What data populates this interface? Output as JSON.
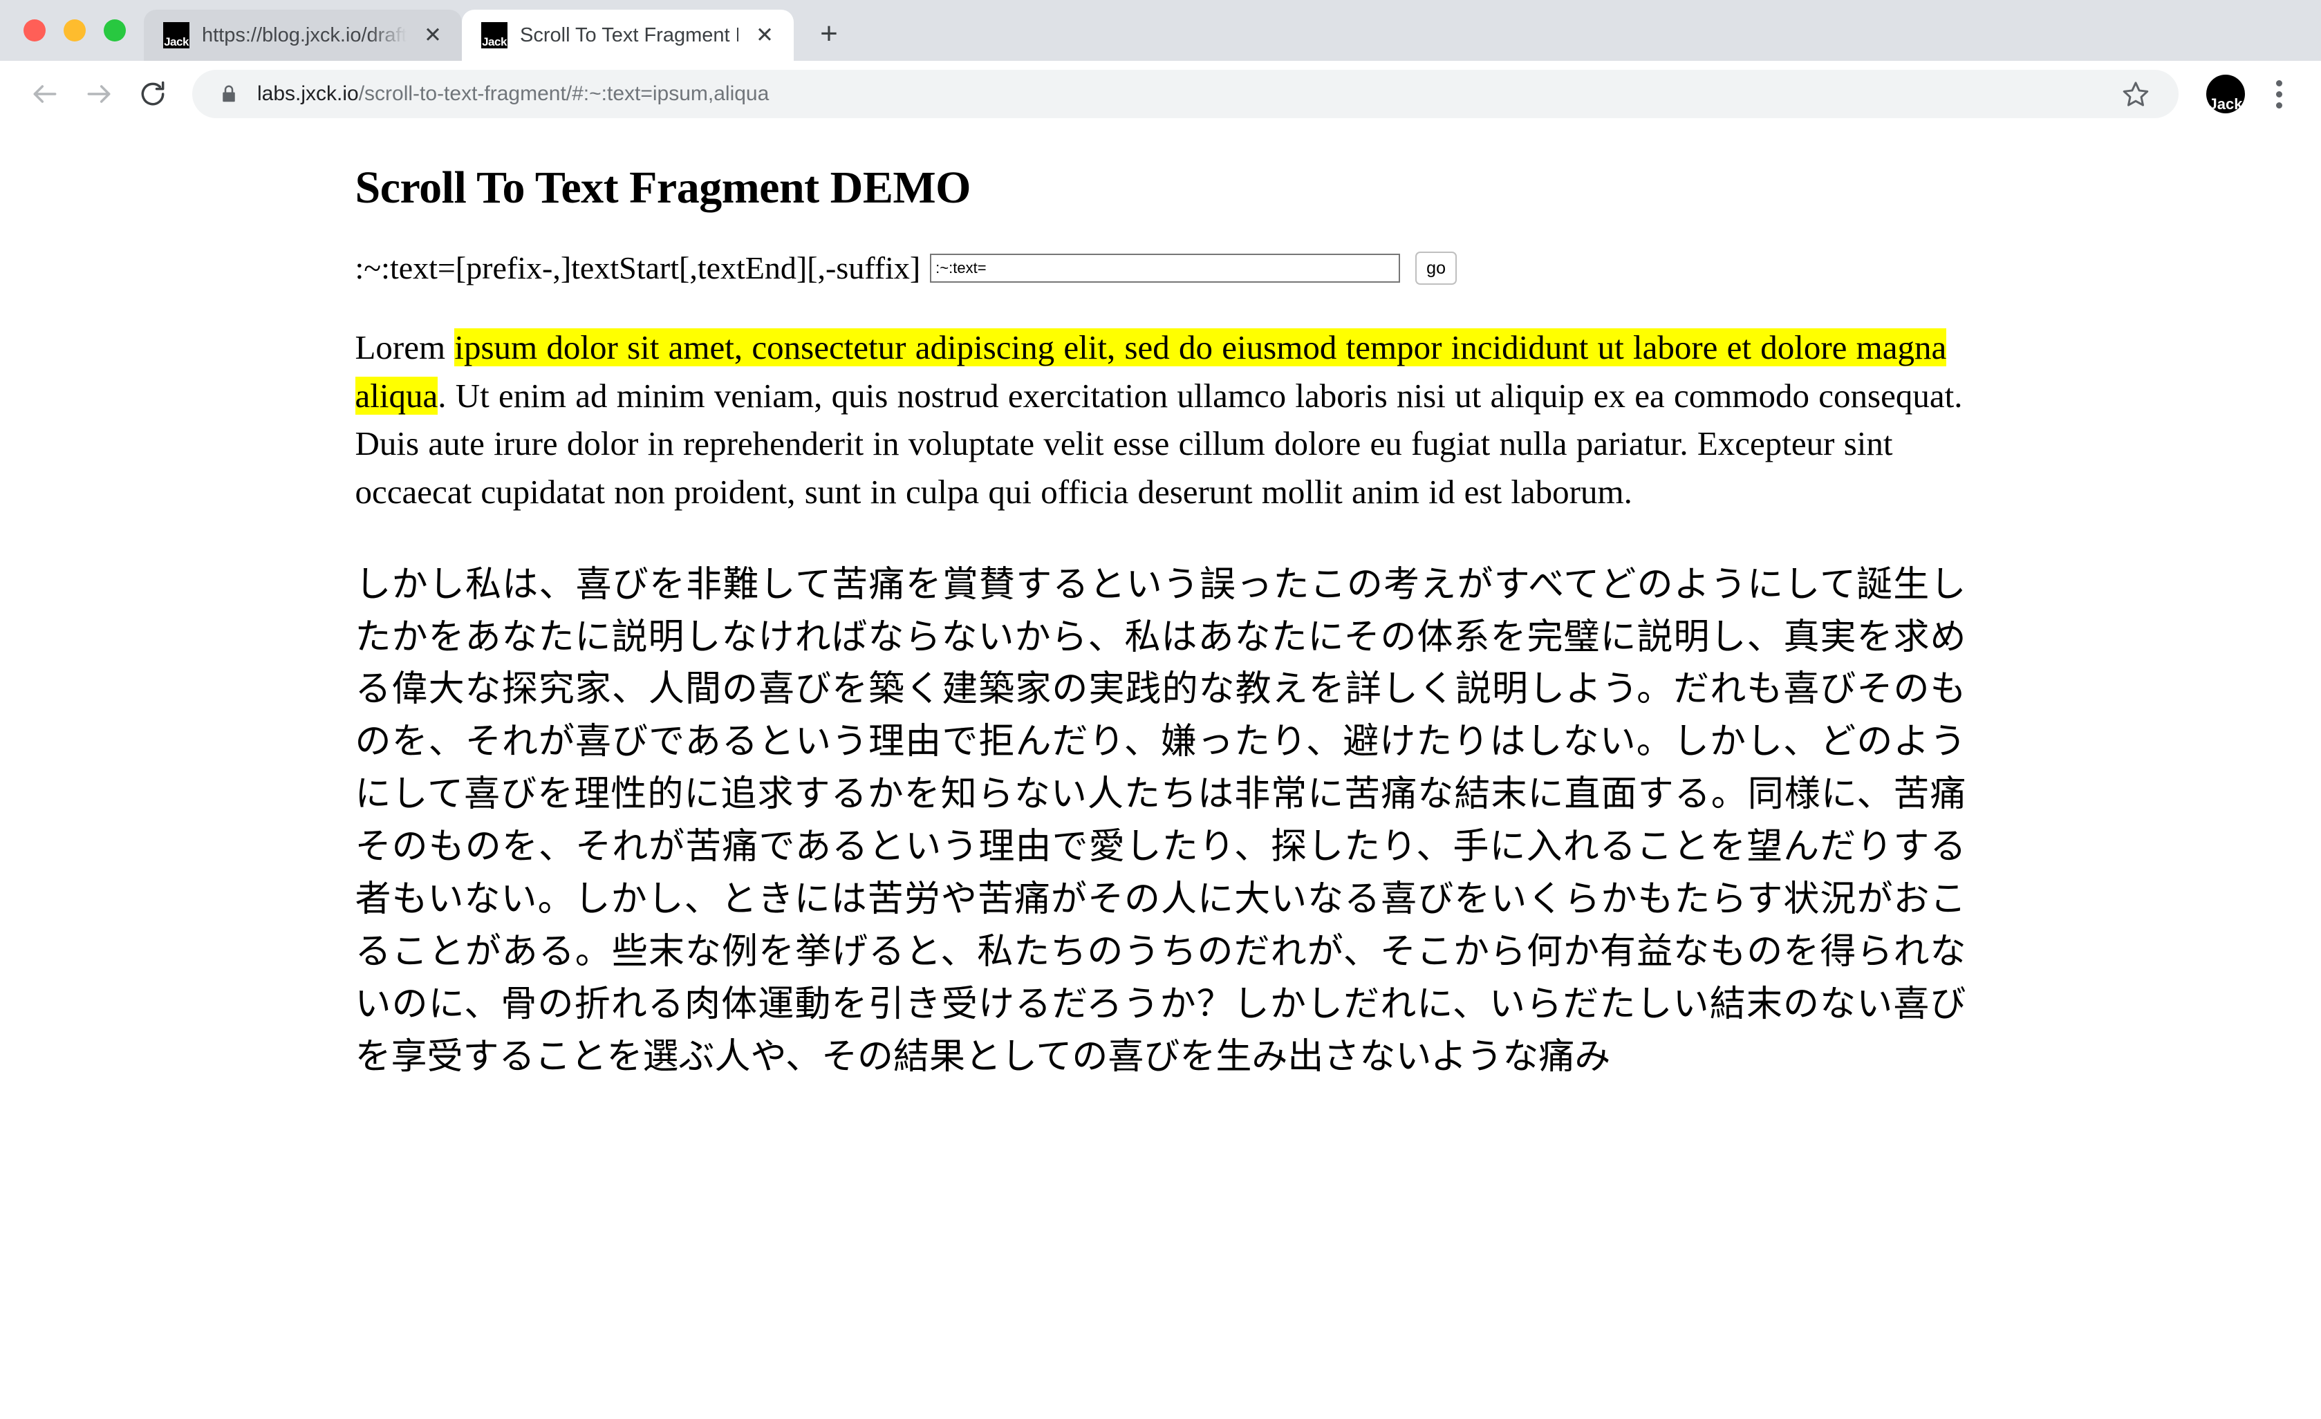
{
  "browser": {
    "window_controls": {
      "close_label": "close",
      "minimize_label": "minimize",
      "maximize_label": "maximize"
    },
    "tabs": [
      {
        "title": "https://blog.jxck.io/drafts/scroll-t",
        "favicon_label": "Jack",
        "active": false,
        "close_glyph": "✕"
      },
      {
        "title": "Scroll To Text Fragment DEMO",
        "favicon_label": "Jack",
        "active": true,
        "close_glyph": "✕"
      }
    ],
    "new_tab_glyph": "+",
    "toolbar": {
      "back_icon": "back-arrow-icon",
      "forward_icon": "forward-arrow-icon",
      "reload_icon": "reload-icon",
      "lock_icon": "lock-icon",
      "url_host": "labs.jxck.io",
      "url_path": "/scroll-to-text-fragment/#:~:text=ipsum,aliqua",
      "url_full": "labs.jxck.io/scroll-to-text-fragment/#:~:text=ipsum,aliqua",
      "bookmark_icon": "star-icon",
      "profile_label": "Jack",
      "menu_icon": "three-dot-menu-icon"
    }
  },
  "page": {
    "title": "Scroll To Text Fragment DEMO",
    "form": {
      "label": ":~:text=[prefix-,]textStart[,textEnd][,-suffix]",
      "input_value": ":~:text=",
      "input_placeholder": ":~:text=",
      "submit_label": "go"
    },
    "latin_paragraph": {
      "before_highlight": "Lorem ",
      "highlight": "ipsum dolor sit amet, consectetur adipiscing elit, sed do eiusmod tempor incididunt ut labore et dolore magna aliqua",
      "after_highlight": ". Ut enim ad minim veniam, quis nostrud exercitation ullamco laboris nisi ut aliquip ex ea commodo consequat. Duis aute irure dolor in reprehenderit in voluptate velit esse cillum dolore eu fugiat nulla pariatur. Excepteur sint occaecat cupidatat non proident, sunt in culpa qui officia deserunt mollit anim id est laborum."
    },
    "japanese_paragraph": "しかし私は、喜びを非難して苦痛を賞賛するという誤ったこの考えがすべてどのようにして誕生したかをあなたに説明しなければならないから、私はあなたにその体系を完璧に説明し、真実を求める偉大な探究家、人間の喜びを築く建築家の実践的な教えを詳しく説明しよう。だれも喜びそのものを、それが喜びであるという理由で拒んだり、嫌ったり、避けたりはしない。しかし、どのようにして喜びを理性的に追求するかを知らない人たちは非常に苦痛な結末に直面する。同様に、苦痛そのものを、それが苦痛であるという理由で愛したり、探したり、手に入れることを望んだりする者もいない。しかし、ときには苦労や苦痛がその人に大いなる喜びをいくらかもたらす状況がおこることがある。些末な例を挙げると、私たちのうちのだれが、そこから何か有益なものを得られないのに、骨の折れる肉体運動を引き受けるだろうか？しかしだれに、いらだたしい結末のない喜びを享受することを選ぶ人や、その結果としての喜びを生み出さないような痛み"
  },
  "colors": {
    "highlight": "#ffff00",
    "tabstrip_bg": "#dee1e6",
    "inactive_tab_bg": "#d3d6db",
    "omnibox_bg": "#f1f3f4",
    "text": "#000000"
  }
}
